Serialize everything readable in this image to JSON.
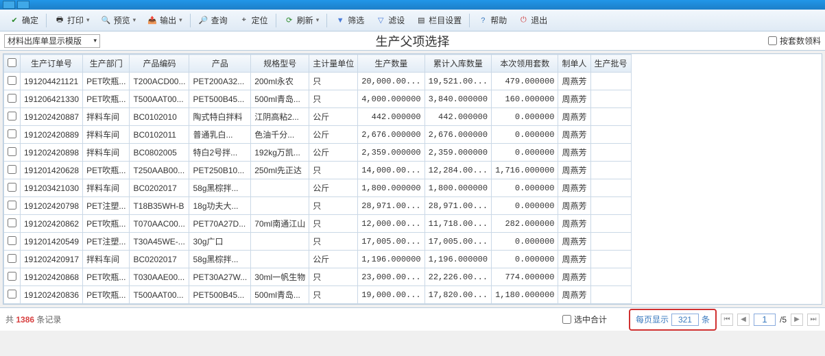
{
  "toolbar": {
    "confirm": "确定",
    "print": "打印",
    "preview": "预览",
    "output": "输出",
    "query": "查询",
    "locate": "定位",
    "refresh": "刷新",
    "filter": "筛选",
    "filterSet": "滤设",
    "colSet": "栏目设置",
    "help": "帮助",
    "exit": "退出"
  },
  "subbar": {
    "templateLabel": "材料出库单显示模版",
    "pageTitle": "生产父项选择",
    "byQtyLabel": "按套数领料"
  },
  "columns": [
    "",
    "生产订单号",
    "生产部门",
    "产品编码",
    "产品",
    "规格型号",
    "主计量单位",
    "生产数量",
    "累计入库数量",
    "本次领用套数",
    "制单人",
    "生产批号"
  ],
  "rows": [
    {
      "order": "191204421121",
      "dept": "PET吹瓶...",
      "code": "T200ACD00...",
      "prod": "PET200A32...",
      "spec": "200ml永农",
      "unit": "只",
      "qty": "20,000.00...",
      "inQty": "19,521.00...",
      "curr": "479.000000",
      "maker": "周燕芳",
      "batch": ""
    },
    {
      "order": "191206421330",
      "dept": "PET吹瓶...",
      "code": "T500AAT00...",
      "prod": "PET500B45...",
      "spec": "500ml青岛...",
      "unit": "只",
      "qty": "4,000.000000",
      "inQty": "3,840.000000",
      "curr": "160.000000",
      "maker": "周燕芳",
      "batch": ""
    },
    {
      "order": "191202420887",
      "dept": "拌料车间",
      "code": "BC0102010",
      "prod": "陶式特白拌料",
      "spec": "江阴高粘2...",
      "unit": "公斤",
      "qty": "442.000000",
      "inQty": "442.000000",
      "curr": "0.000000",
      "maker": "周燕芳",
      "batch": ""
    },
    {
      "order": "191202420889",
      "dept": "拌料车间",
      "code": "BC0102011",
      "prod": "普通乳白...",
      "spec": "色油千分...",
      "unit": "公斤",
      "qty": "2,676.000000",
      "inQty": "2,676.000000",
      "curr": "0.000000",
      "maker": "周燕芳",
      "batch": ""
    },
    {
      "order": "191202420898",
      "dept": "拌料车间",
      "code": "BC0802005",
      "prod": "特白2号拌...",
      "spec": "192kg万凯...",
      "unit": "公斤",
      "qty": "2,359.000000",
      "inQty": "2,359.000000",
      "curr": "0.000000",
      "maker": "周燕芳",
      "batch": ""
    },
    {
      "order": "191201420628",
      "dept": "PET吹瓶...",
      "code": "T250AAB00...",
      "prod": "PET250B10...",
      "spec": "250ml先正达",
      "unit": "只",
      "qty": "14,000.00...",
      "inQty": "12,284.00...",
      "curr": "1,716.000000",
      "maker": "周燕芳",
      "batch": ""
    },
    {
      "order": "191203421030",
      "dept": "拌料车间",
      "code": "BC0202017",
      "prod": "58g黑棕拌...",
      "spec": "",
      "unit": "公斤",
      "qty": "1,800.000000",
      "inQty": "1,800.000000",
      "curr": "0.000000",
      "maker": "周燕芳",
      "batch": ""
    },
    {
      "order": "191202420798",
      "dept": "PET注塑...",
      "code": "T18B35WH-B",
      "prod": "18g功夫大...",
      "spec": "",
      "unit": "只",
      "qty": "28,971.00...",
      "inQty": "28,971.00...",
      "curr": "0.000000",
      "maker": "周燕芳",
      "batch": ""
    },
    {
      "order": "191202420862",
      "dept": "PET吹瓶...",
      "code": "T070AAC00...",
      "prod": "PET70A27D...",
      "spec": "70ml南通江山",
      "unit": "只",
      "qty": "12,000.00...",
      "inQty": "11,718.00...",
      "curr": "282.000000",
      "maker": "周燕芳",
      "batch": ""
    },
    {
      "order": "191201420549",
      "dept": "PET注塑...",
      "code": "T30A45WE-...",
      "prod": "30g广口",
      "spec": "",
      "unit": "只",
      "qty": "17,005.00...",
      "inQty": "17,005.00...",
      "curr": "0.000000",
      "maker": "周燕芳",
      "batch": ""
    },
    {
      "order": "191202420917",
      "dept": "拌料车间",
      "code": "BC0202017",
      "prod": "58g黑棕拌...",
      "spec": "",
      "unit": "公斤",
      "qty": "1,196.000000",
      "inQty": "1,196.000000",
      "curr": "0.000000",
      "maker": "周燕芳",
      "batch": ""
    },
    {
      "order": "191202420868",
      "dept": "PET吹瓶...",
      "code": "T030AAE00...",
      "prod": "PET30A27W...",
      "spec": "30ml一帆生物",
      "unit": "只",
      "qty": "23,000.00...",
      "inQty": "22,226.00...",
      "curr": "774.000000",
      "maker": "周燕芳",
      "batch": ""
    },
    {
      "order": "191202420836",
      "dept": "PET吹瓶...",
      "code": "T500AAT00...",
      "prod": "PET500B45...",
      "spec": "500ml青岛...",
      "unit": "只",
      "qty": "19,000.00...",
      "inQty": "17,820.00...",
      "curr": "1,180.000000",
      "maker": "周燕芳",
      "batch": ""
    }
  ],
  "footer": {
    "totalPrefix": "共",
    "totalCount": "1386",
    "totalSuffix": "条记录",
    "sumLabel": "选中合计",
    "pageSizeLabel": "每页显示",
    "pageSize": "321",
    "pageSizeUnit": "条",
    "currentPage": "1",
    "totalPages": "/5"
  }
}
